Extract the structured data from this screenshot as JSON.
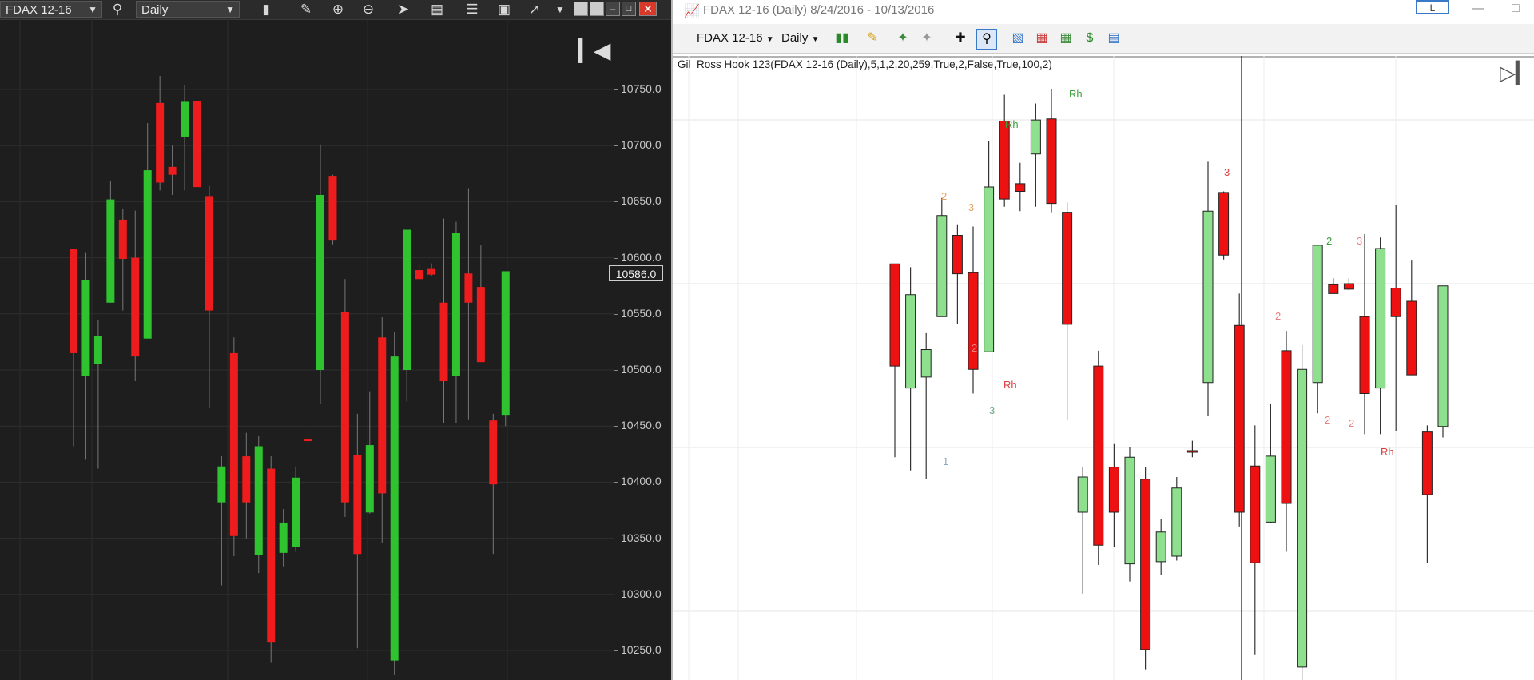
{
  "left": {
    "symbol": "FDAX 12-16",
    "interval": "Daily",
    "current_price": "10586.0",
    "y_ticks": [
      "10750.0",
      "10700.0",
      "10650.0",
      "10600.0",
      "10550.0",
      "10500.0",
      "10450.0",
      "10400.0",
      "10350.0",
      "10300.0",
      "10250.0"
    ],
    "icons": [
      "search-icon",
      "candles-icon",
      "pencil-icon",
      "zoom-in-icon",
      "zoom-out-icon",
      "pointer-icon",
      "data-box-icon",
      "bars-icon",
      "layout-icon",
      "drawing-icon",
      "dropdown-icon"
    ]
  },
  "right": {
    "window_title": "FDAX 12-16 (Daily)  8/24/2016 - 10/13/2016",
    "layout_button": "L",
    "symbol": "FDAX 12-16",
    "interval": "Daily",
    "indicator_label": "Gil_Ross Hook 123(FDAX 12-16 (Daily),5,1,2,20,259,True,2,False,True,100,2)",
    "annotations": [
      {
        "text": "2",
        "color": "#e6a060"
      },
      {
        "text": "3",
        "color": "#e6a060"
      },
      {
        "text": "2",
        "color": "#e88080"
      },
      {
        "text": "Rh",
        "color": "#d84040"
      },
      {
        "text": "3",
        "color": "#6aaa88"
      },
      {
        "text": "1",
        "color": "#8ab"
      },
      {
        "text": "Rh",
        "color": "#3aa03a"
      },
      {
        "text": "Rh",
        "color": "#3aa03a"
      },
      {
        "text": "3",
        "color": "#d84040"
      },
      {
        "text": "2",
        "color": "#e88080"
      },
      {
        "text": "2",
        "color": "#e88080"
      },
      {
        "text": "2",
        "color": "#3aa03a"
      },
      {
        "text": "3",
        "color": "#e88080"
      },
      {
        "text": "2",
        "color": "#e88080"
      },
      {
        "text": "Rh",
        "color": "#d84040"
      }
    ]
  },
  "chart_data": [
    {
      "type": "candlestick",
      "title": "FDAX 12-16 Daily",
      "ylim": [
        10220,
        10790
      ],
      "candles": [
        {
          "o": 10515,
          "h": 10602,
          "l": 10432,
          "c": 10608,
          "up": false
        },
        {
          "o": 10495,
          "h": 10605,
          "l": 10420,
          "c": 10580,
          "up": true
        },
        {
          "o": 10505,
          "h": 10545,
          "l": 10412,
          "c": 10530,
          "up": true
        },
        {
          "o": 10560,
          "h": 10668,
          "l": 10560,
          "c": 10652,
          "up": true
        },
        {
          "o": 10634,
          "h": 10644,
          "l": 10553,
          "c": 10599,
          "up": false
        },
        {
          "o": 10600,
          "h": 10642,
          "l": 10490,
          "c": 10512,
          "up": false
        },
        {
          "o": 10528,
          "h": 10720,
          "l": 10528,
          "c": 10678,
          "up": true
        },
        {
          "o": 10738,
          "h": 10762,
          "l": 10660,
          "c": 10667,
          "up": false
        },
        {
          "o": 10681,
          "h": 10700,
          "l": 10656,
          "c": 10674,
          "up": false
        },
        {
          "o": 10708,
          "h": 10754,
          "l": 10660,
          "c": 10739,
          "up": true
        },
        {
          "o": 10740,
          "h": 10767,
          "l": 10655,
          "c": 10663,
          "up": false
        },
        {
          "o": 10655,
          "h": 10664,
          "l": 10466,
          "c": 10553,
          "up": false
        },
        {
          "o": 10382,
          "h": 10423,
          "l": 10308,
          "c": 10414,
          "up": true
        },
        {
          "o": 10515,
          "h": 10529,
          "l": 10334,
          "c": 10352,
          "up": false
        },
        {
          "o": 10382,
          "h": 10444,
          "l": 10350,
          "c": 10423,
          "up": false
        },
        {
          "o": 10335,
          "h": 10441,
          "l": 10319,
          "c": 10432,
          "up": true
        },
        {
          "o": 10412,
          "h": 10423,
          "l": 10239,
          "c": 10257,
          "up": false
        },
        {
          "o": 10337,
          "h": 10376,
          "l": 10325,
          "c": 10364,
          "up": true
        },
        {
          "o": 10342,
          "h": 10414,
          "l": 10338,
          "c": 10404,
          "up": true
        },
        {
          "o": 10438,
          "h": 10447,
          "l": 10432,
          "c": 10437,
          "up": false
        },
        {
          "o": 10500,
          "h": 10701,
          "l": 10470,
          "c": 10656,
          "up": true
        },
        {
          "o": 10673,
          "h": 10674,
          "l": 10612,
          "c": 10616,
          "up": false
        },
        {
          "o": 10552,
          "h": 10581,
          "l": 10369,
          "c": 10382,
          "up": false
        },
        {
          "o": 10424,
          "h": 10461,
          "l": 10252,
          "c": 10336,
          "up": false
        },
        {
          "o": 10373,
          "h": 10481,
          "l": 10372,
          "c": 10433,
          "up": true
        },
        {
          "o": 10529,
          "h": 10547,
          "l": 10346,
          "c": 10390,
          "up": false
        },
        {
          "o": 10512,
          "h": 10534,
          "l": 10228,
          "c": 10241,
          "up": true
        },
        {
          "o": 10500,
          "h": 10617,
          "l": 10472,
          "c": 10625,
          "up": true
        },
        {
          "o": 10589,
          "h": 10595,
          "l": 10584,
          "c": 10581,
          "up": false
        },
        {
          "o": 10590,
          "h": 10595,
          "l": 10584,
          "c": 10585,
          "up": false
        },
        {
          "o": 10560,
          "h": 10635,
          "l": 10453,
          "c": 10490,
          "up": false
        },
        {
          "o": 10495,
          "h": 10632,
          "l": 10453,
          "c": 10622,
          "up": true
        },
        {
          "o": 10586,
          "h": 10662,
          "l": 10456,
          "c": 10560,
          "up": false
        },
        {
          "o": 10574,
          "h": 10611,
          "l": 10509,
          "c": 10507,
          "up": false
        },
        {
          "o": 10455,
          "h": 10461,
          "l": 10336,
          "c": 10398,
          "up": false
        },
        {
          "o": 10460,
          "h": 10588,
          "l": 10450,
          "c": 10588,
          "up": true
        }
      ]
    },
    {
      "type": "candlestick",
      "title": "FDAX 12-16 (Daily) 8/24/2016 - 10/13/2016",
      "candles_note": "same session rendered in light theme"
    }
  ]
}
